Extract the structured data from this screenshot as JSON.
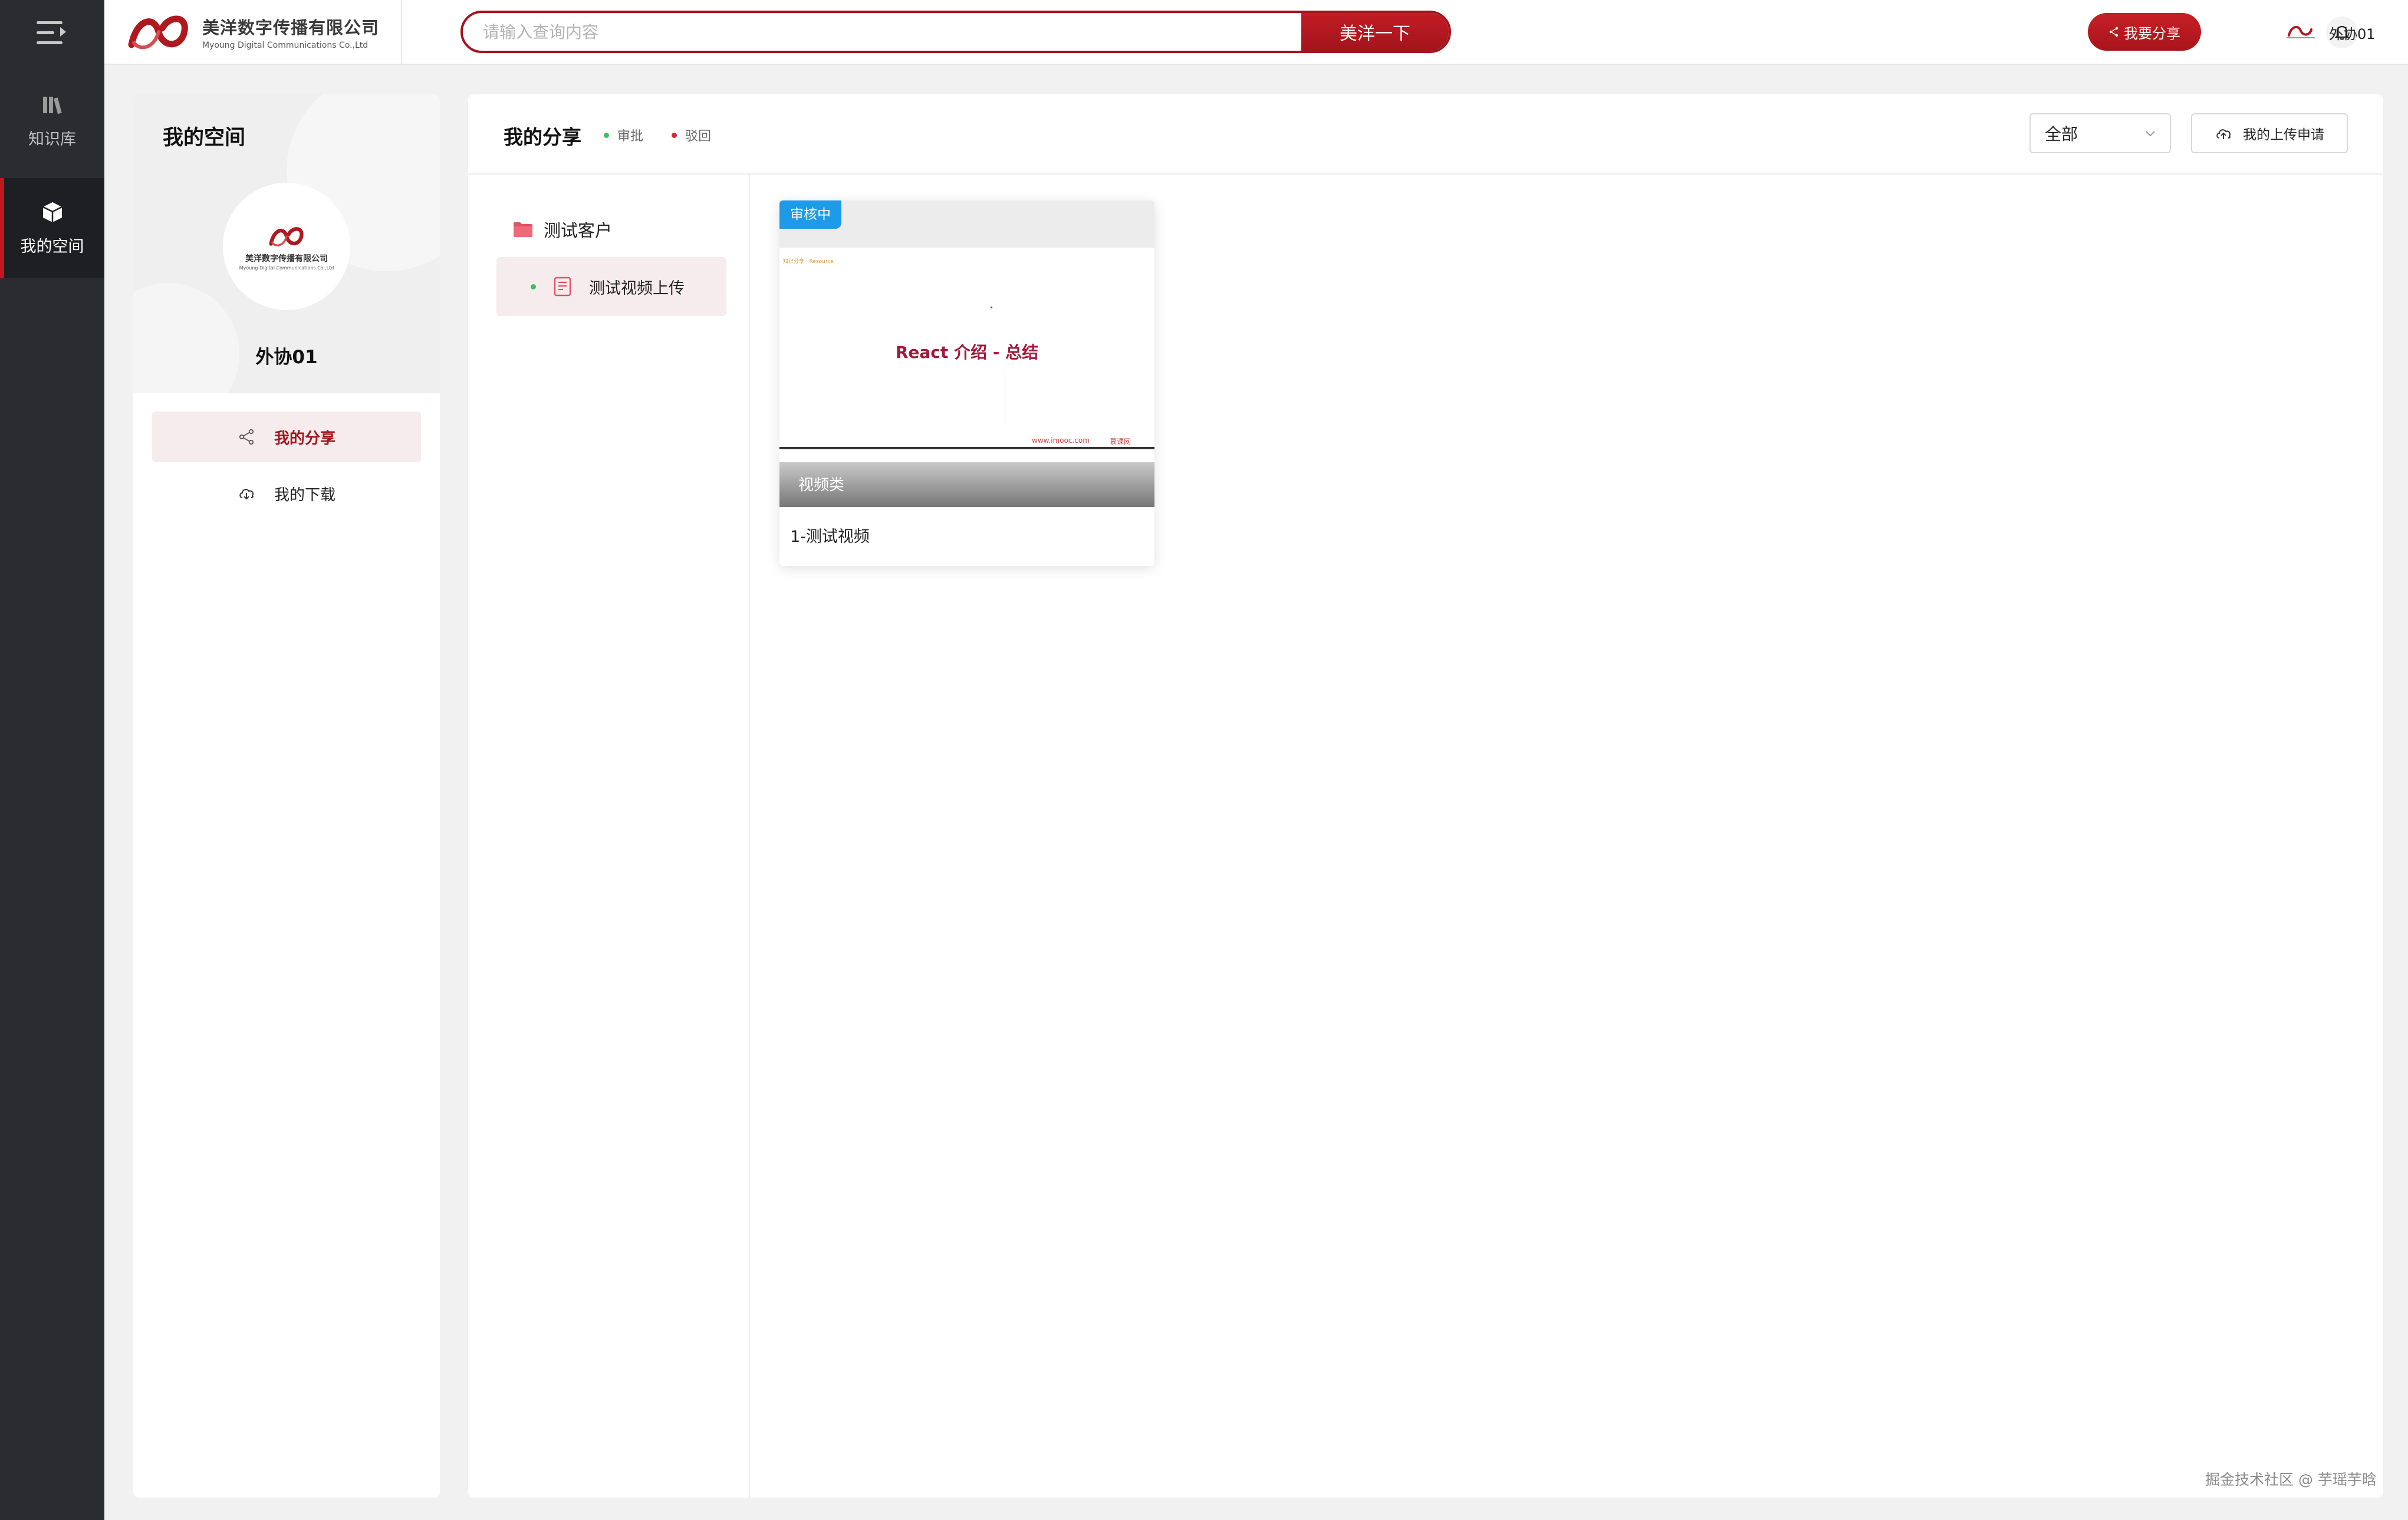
{
  "brand": {
    "name_cn": "美洋数字传播有限公司",
    "name_en": "Myoung Digital Communications Co.,Ltd",
    "accent_color": "#a3141c"
  },
  "nav": {
    "items": [
      {
        "label": "知识库",
        "icon": "books-icon",
        "active": false
      },
      {
        "label": "我的空间",
        "icon": "cube-icon",
        "active": true
      }
    ]
  },
  "header": {
    "search_placeholder": "请输入查询内容",
    "search_value": "",
    "search_button": "美洋一下",
    "share_button": "我要分享",
    "username": "外协01"
  },
  "profile": {
    "title": "我的空间",
    "name": "外协01",
    "menu": [
      {
        "label": "我的分享",
        "icon": "share-icon",
        "active": true
      },
      {
        "label": "我的下载",
        "icon": "cloud-download-icon",
        "active": false
      }
    ]
  },
  "main": {
    "title": "我的分享",
    "legend": [
      {
        "label": "审批",
        "color": "#3fbf5f"
      },
      {
        "label": "驳回",
        "color": "#d9232d"
      }
    ],
    "filter_value": "全部",
    "upload_button": "我的上传申请",
    "tree": {
      "folder": "测试客户",
      "file": "测试视频上传"
    },
    "cards": [
      {
        "badge": "审核中",
        "slide_tag": "知识分享 · Resource",
        "slide_title": "React 介绍 - 总结",
        "slide_url": "www.imooc.com",
        "slide_brand": "慕课网",
        "category": "视频类",
        "name": "1-测试视频"
      }
    ]
  },
  "footer": {
    "watermark": "掘金技术社区 @ 芋瑶芋晗"
  }
}
